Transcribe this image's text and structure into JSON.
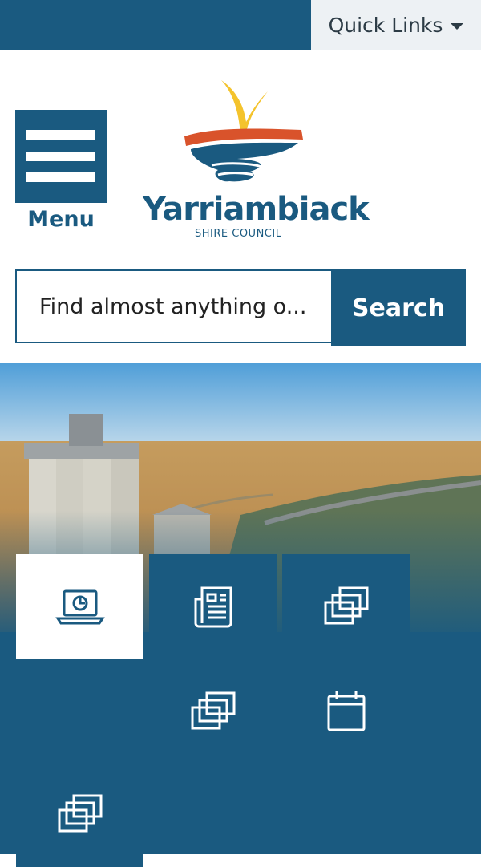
{
  "topbar": {
    "quick_links_label": "Quick Links",
    "caret_icon": "caret-down-icon"
  },
  "header": {
    "menu_label": "Menu",
    "logo": {
      "title": "Yarriambiack",
      "subtitle": "SHIRE COUNCIL"
    }
  },
  "search": {
    "placeholder": "Find almost anything o...",
    "button_label": "Search"
  },
  "tiles": [
    {
      "icon": "laptop-clock-icon",
      "active": true
    },
    {
      "icon": "newspaper-icon",
      "active": false
    },
    {
      "icon": "stacked-windows-icon",
      "active": false
    },
    {
      "icon": "stacked-windows-icon",
      "active": false
    },
    {
      "icon": "calendar-icon",
      "active": false
    },
    {
      "icon": "stacked-windows-icon",
      "active": false
    }
  ],
  "colors": {
    "primary": "#1a5a80",
    "quick_links_bg": "#edf1f4",
    "logo_yellow": "#f4c32c",
    "logo_orange": "#d9532b"
  }
}
